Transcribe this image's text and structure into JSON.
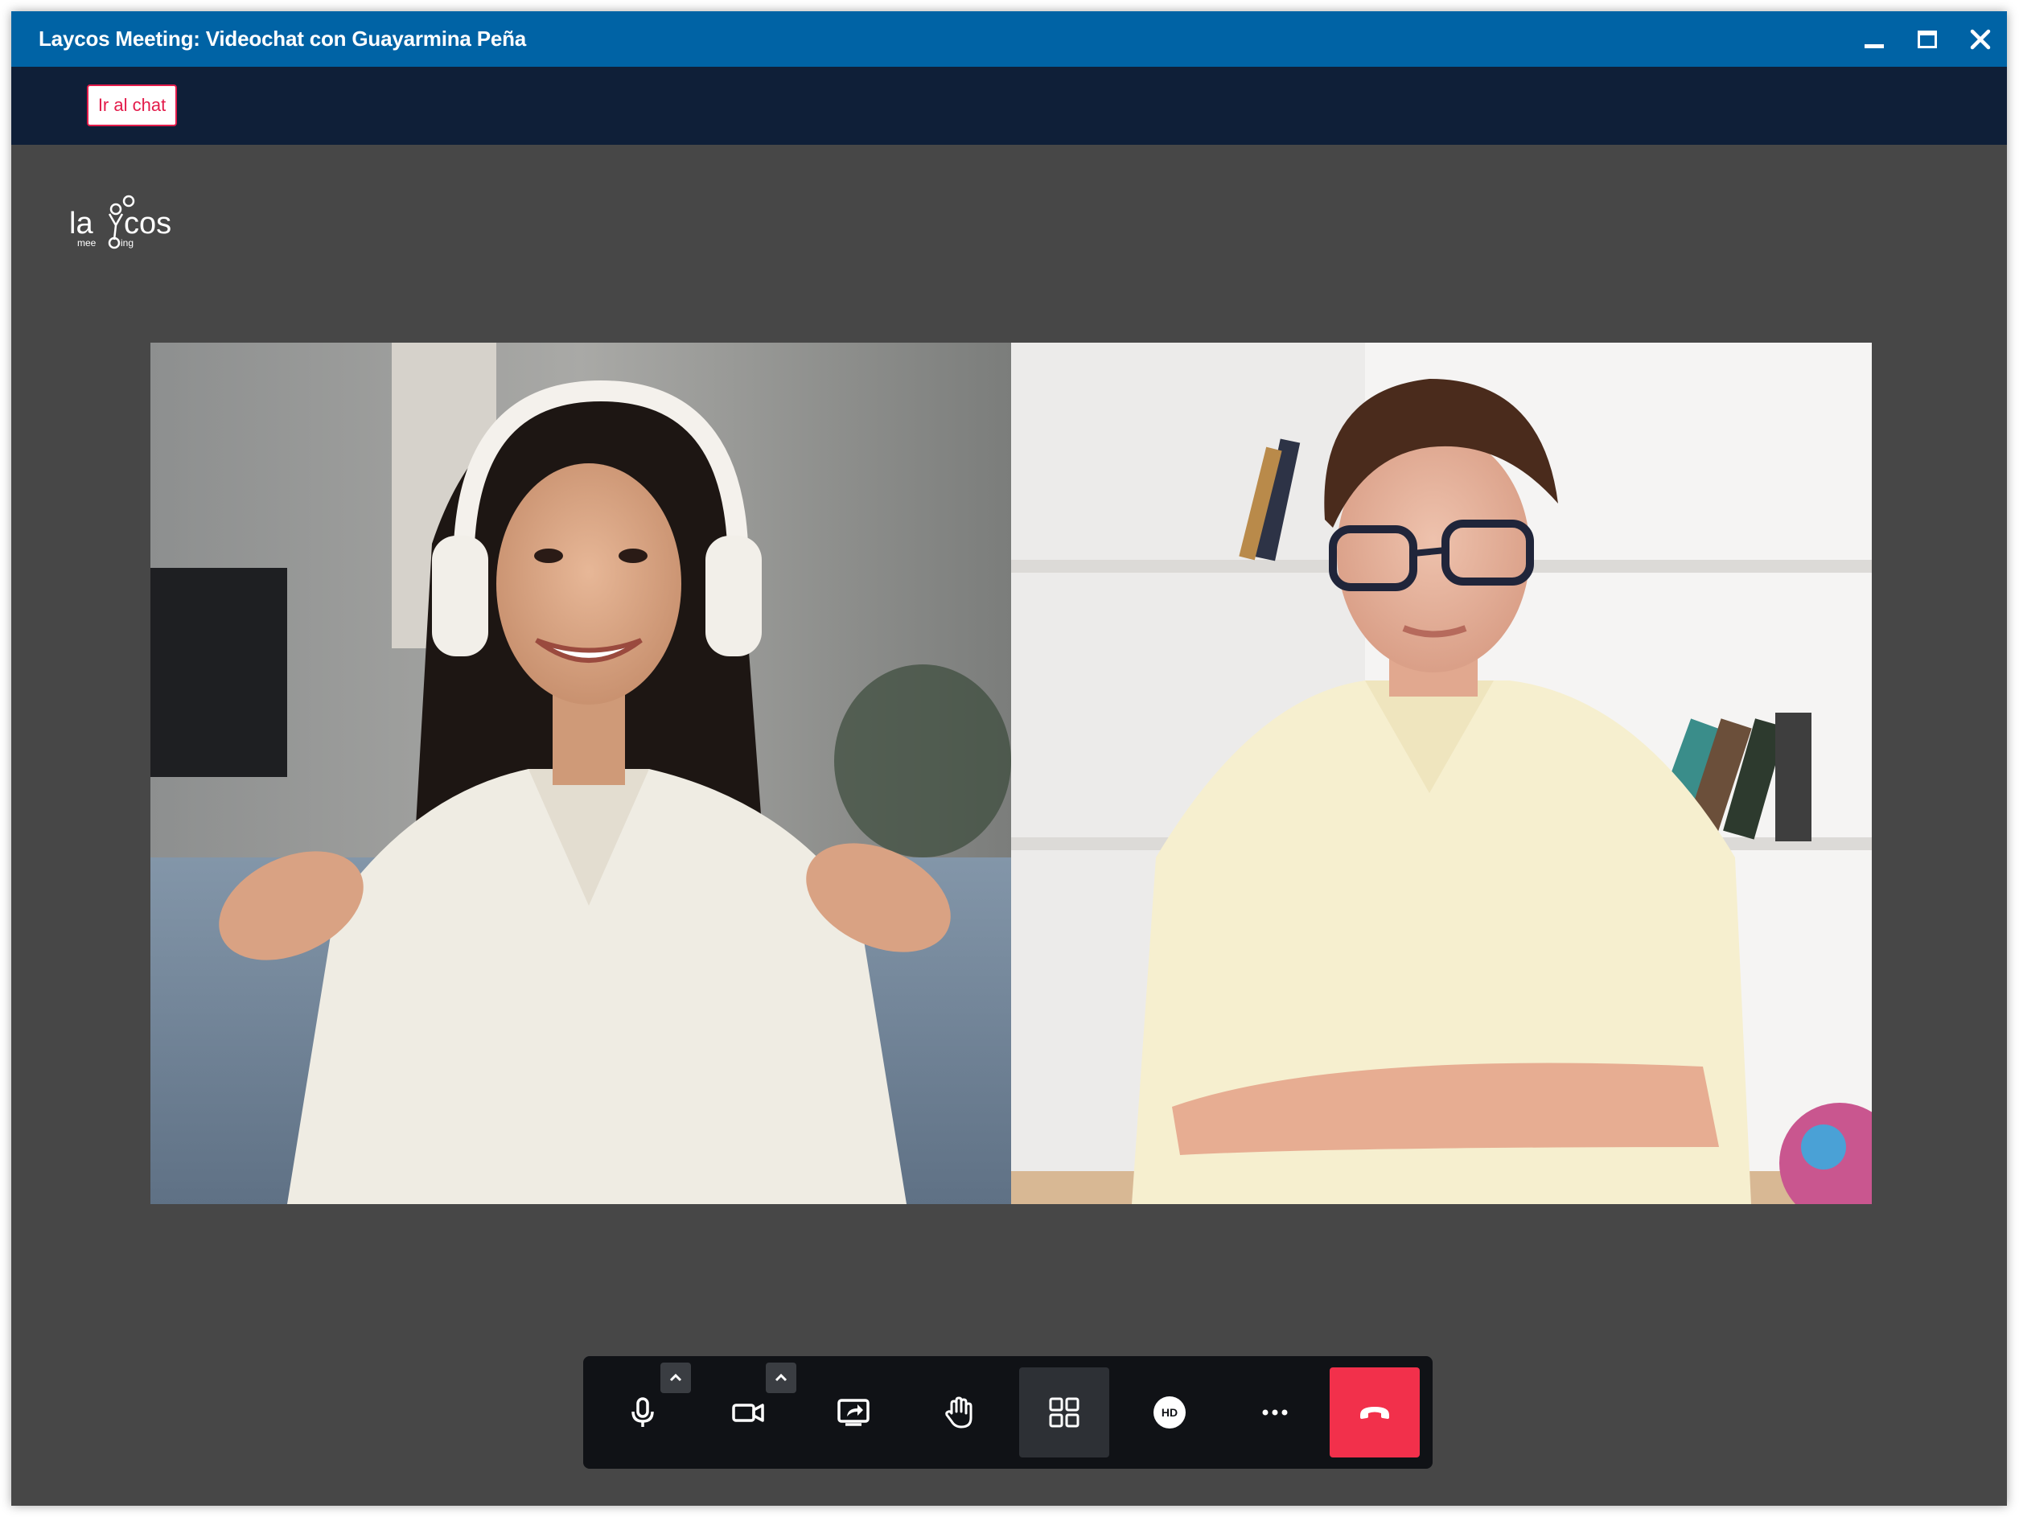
{
  "window": {
    "title": "Laycos Meeting: Videochat con Guayarmina Peña",
    "controls": [
      "minimize-icon",
      "maximize-icon",
      "close-icon"
    ]
  },
  "toolbar": {
    "chat_button_label": "Ir al chat"
  },
  "logo": {
    "text": "laycos",
    "subtext": "meeting"
  },
  "participants": [
    {
      "tile": "participant-left",
      "description_icon": "video-feed"
    },
    {
      "tile": "participant-right",
      "description_icon": "video-feed"
    }
  ],
  "call_controls": [
    {
      "name": "microphone-icon",
      "has_options_caret": true
    },
    {
      "name": "camera-icon",
      "has_options_caret": true
    },
    {
      "name": "screen-share-icon"
    },
    {
      "name": "raise-hand-icon"
    },
    {
      "name": "grid-layout-icon",
      "active": true
    },
    {
      "name": "hd-quality-icon",
      "label": "HD"
    },
    {
      "name": "more-options-icon"
    },
    {
      "name": "hang-up-icon"
    }
  ],
  "colors": {
    "titlebar": "#0063a5",
    "toolbar": "#0f1f38",
    "stage": "#474747",
    "accent": "#e31b4a",
    "hangup": "#f2304b"
  }
}
